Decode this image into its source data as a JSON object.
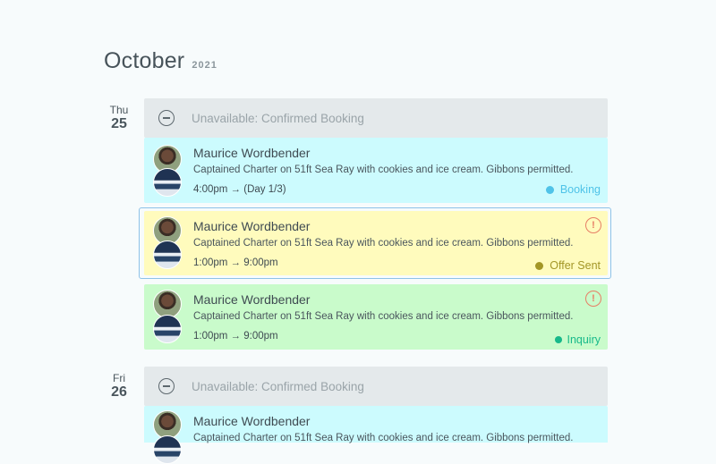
{
  "header": {
    "month": "October",
    "year": "2021"
  },
  "days": [
    {
      "dow": "Thu",
      "date": "25"
    },
    {
      "dow": "Fri",
      "date": "26"
    }
  ],
  "unavailable_label": "Unavailable: Confirmed Booking",
  "cards": [
    {
      "name": "Maurice Wordbender",
      "description": "Captained Charter on 51ft Sea Ray with cookies and ice cream. Gibbons permitted.",
      "time": "4:00pm →  (Day 1/3)",
      "status": "Booking",
      "status_color": "#4fc3e8",
      "alert": false,
      "style": "booking"
    },
    {
      "name": "Maurice Wordbender",
      "description": "Captained Charter on 51ft Sea Ray with cookies and ice cream. Gibbons permitted.",
      "time": "1:00pm → 9:00pm",
      "status": "Offer Sent",
      "status_color": "#a39626",
      "alert": true,
      "alert_symbol": "!",
      "style": "offer"
    },
    {
      "name": "Maurice Wordbender",
      "description": "Captained Charter on 51ft Sea Ray with cookies and ice cream. Gibbons permitted.",
      "time": "1:00pm → 9:00pm",
      "status": "Inquiry",
      "status_color": "#17b98a",
      "alert": true,
      "alert_symbol": "!",
      "style": "inquiry"
    },
    {
      "name": "Maurice Wordbender",
      "description": "Captained Charter on 51ft Sea Ray with cookies and ice cream. Gibbons permitted.",
      "style": "booking"
    }
  ],
  "icons": {
    "minus": "minus-circle-icon",
    "alert": "exclamation-circle-icon",
    "avatar": "user-avatar",
    "boat": "boat-photo"
  }
}
